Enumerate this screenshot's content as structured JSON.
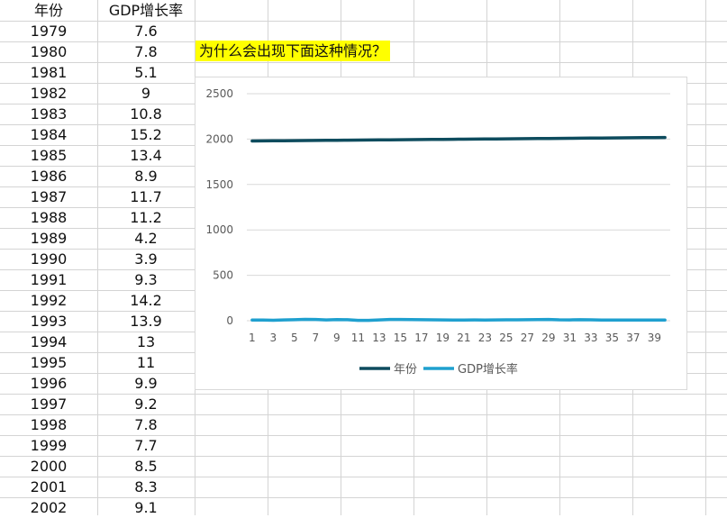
{
  "sheet": {
    "headers": [
      "年份",
      "GDP增长率"
    ],
    "rows": [
      [
        "1979",
        "7.6"
      ],
      [
        "1980",
        "7.8"
      ],
      [
        "1981",
        "5.1"
      ],
      [
        "1982",
        "9"
      ],
      [
        "1983",
        "10.8"
      ],
      [
        "1984",
        "15.2"
      ],
      [
        "1985",
        "13.4"
      ],
      [
        "1986",
        "8.9"
      ],
      [
        "1987",
        "11.7"
      ],
      [
        "1988",
        "11.2"
      ],
      [
        "1989",
        "4.2"
      ],
      [
        "1990",
        "3.9"
      ],
      [
        "1991",
        "9.3"
      ],
      [
        "1992",
        "14.2"
      ],
      [
        "1993",
        "13.9"
      ],
      [
        "1994",
        "13"
      ],
      [
        "1995",
        "11"
      ],
      [
        "1996",
        "9.9"
      ],
      [
        "1997",
        "9.2"
      ],
      [
        "1998",
        "7.8"
      ],
      [
        "1999",
        "7.7"
      ],
      [
        "2000",
        "8.5"
      ],
      [
        "2001",
        "8.3"
      ],
      [
        "2002",
        "9.1"
      ]
    ]
  },
  "question": "为什么会出现下面这种情况？",
  "chart_data": {
    "type": "line",
    "x": [
      1,
      2,
      3,
      4,
      5,
      6,
      7,
      8,
      9,
      10,
      11,
      12,
      13,
      14,
      15,
      16,
      17,
      18,
      19,
      20,
      21,
      22,
      23,
      24,
      25,
      26,
      27,
      28,
      29,
      30,
      31,
      32,
      33,
      34,
      35,
      36,
      37,
      38,
      39,
      40
    ],
    "x_tick_labels": [
      "1",
      "3",
      "5",
      "7",
      "9",
      "11",
      "13",
      "15",
      "17",
      "19",
      "21",
      "23",
      "25",
      "27",
      "29",
      "31",
      "33",
      "35",
      "37",
      "39"
    ],
    "ylim": [
      0,
      2500
    ],
    "y_ticks": [
      0,
      500,
      1000,
      1500,
      2000,
      2500
    ],
    "grid": true,
    "legend": "bottom",
    "series": [
      {
        "name": "年份",
        "color": "#0e4c5e",
        "values": [
          1979,
          1980,
          1981,
          1982,
          1983,
          1984,
          1985,
          1986,
          1987,
          1988,
          1989,
          1990,
          1991,
          1992,
          1993,
          1994,
          1995,
          1996,
          1997,
          1998,
          1999,
          2000,
          2001,
          2002,
          2003,
          2004,
          2005,
          2006,
          2007,
          2008,
          2009,
          2010,
          2011,
          2012,
          2013,
          2014,
          2015,
          2016,
          2017,
          2018
        ]
      },
      {
        "name": "GDP增长率",
        "color": "#1fa0cf",
        "values": [
          7.6,
          7.8,
          5.1,
          9,
          10.8,
          15.2,
          13.4,
          8.9,
          11.7,
          11.2,
          4.2,
          3.9,
          9.3,
          14.2,
          13.9,
          13,
          11,
          9.9,
          9.2,
          7.8,
          7.7,
          8.5,
          8.3,
          9.1,
          10,
          10.1,
          11.4,
          12.7,
          14.2,
          9.7,
          9.4,
          10.6,
          9.6,
          7.9,
          7.8,
          7.3,
          6.9,
          6.7,
          6.8,
          6.6
        ]
      }
    ]
  }
}
